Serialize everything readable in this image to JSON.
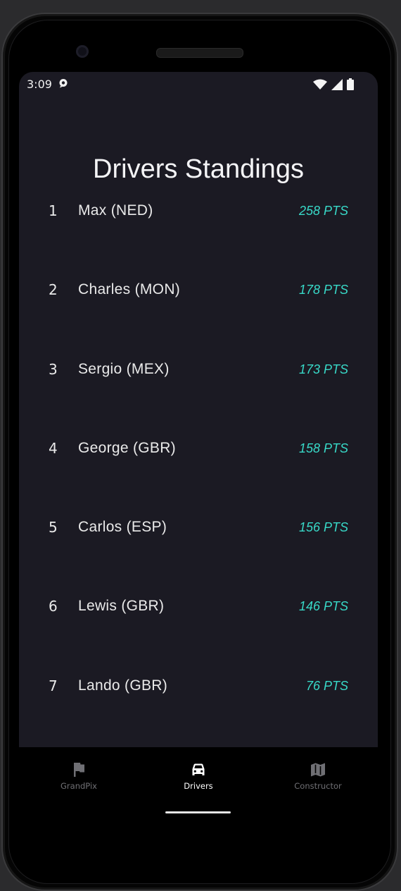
{
  "status_bar": {
    "time": "3:09",
    "notification_icon": "chat-bubble-icon",
    "icons": [
      "wifi-icon",
      "signal-icon",
      "battery-icon"
    ]
  },
  "page": {
    "title": "Drivers Standings"
  },
  "drivers": [
    {
      "pos": "1",
      "name": "Max (NED)",
      "pts": "258 PTS"
    },
    {
      "pos": "2",
      "name": "Charles (MON)",
      "pts": "178 PTS"
    },
    {
      "pos": "3",
      "name": "Sergio (MEX)",
      "pts": "173 PTS"
    },
    {
      "pos": "4",
      "name": "George (GBR)",
      "pts": "158 PTS"
    },
    {
      "pos": "5",
      "name": "Carlos (ESP)",
      "pts": "156 PTS"
    },
    {
      "pos": "6",
      "name": "Lewis (GBR)",
      "pts": "146 PTS"
    },
    {
      "pos": "7",
      "name": "Lando (GBR)",
      "pts": "76 PTS"
    }
  ],
  "bottom_nav": {
    "items": [
      {
        "label": "GrandPix",
        "icon": "flag-icon",
        "active": false
      },
      {
        "label": "Drivers",
        "icon": "car-icon",
        "active": true
      },
      {
        "label": "Constructor",
        "icon": "map-icon",
        "active": false
      }
    ]
  },
  "colors": {
    "background": "#1b1a23",
    "points_accent": "#38d9c8",
    "text": "#eaeaea",
    "nav_inactive": "#6f6f74"
  }
}
